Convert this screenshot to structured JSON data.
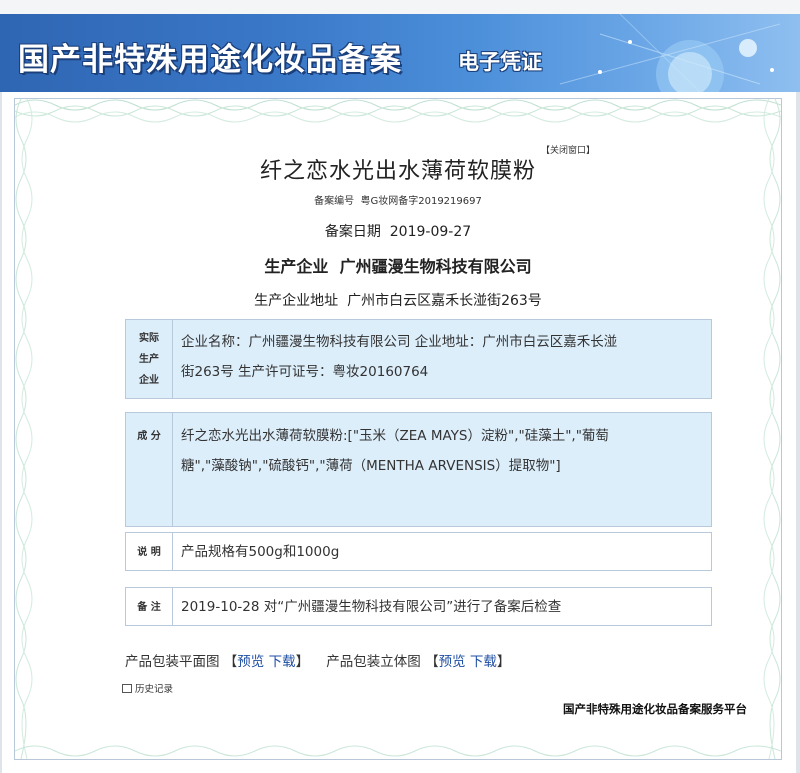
{
  "banner": {
    "title": "国产非特殊用途化妆品备案",
    "subtitle": "电子凭证"
  },
  "close_link": "【关闭窗口】",
  "product_name": "纤之恋水光出水薄荷软膜粉",
  "registration": {
    "number_label": "备案编号",
    "number": "粤G妆网备字2019219697",
    "date_label": "备案日期",
    "date": "2019-09-27"
  },
  "manufacturer": {
    "label": "生产企业",
    "name": "广州疆漫生物科技有限公司",
    "address_label": "生产企业地址",
    "address": "广州市白云区嘉禾长湴街263号"
  },
  "sections": {
    "actual_company": {
      "label_lines": [
        "实际",
        "生产",
        "企业"
      ],
      "line1": "企业名称：广州疆漫生物科技有限公司 企业地址：广州市白云区嘉禾长湴",
      "line2": "街263号 生产许可证号：粤妆20160764"
    },
    "ingredients": {
      "label": "成 分",
      "line1": "纤之恋水光出水薄荷软膜粉:[\"玉米（ZEA MAYS）淀粉\",\"硅藻土\",\"葡萄",
      "line2": "糖\",\"藻酸钠\",\"硫酸钙\",\"薄荷（MENTHA ARVENSIS）提取物\"]"
    },
    "description": {
      "label": "说 明",
      "text": "产品规格有500g和1000g"
    },
    "remarks": {
      "label": "备 注",
      "text": "2019-10-28 对“广州疆漫生物科技有限公司”进行了备案后检查"
    }
  },
  "packaging": {
    "flat_label": "产品包装平面图",
    "solid_label": "产品包装立体图",
    "open_bracket": "【",
    "close_bracket": "】",
    "preview": "预览",
    "download": "下载"
  },
  "history_link": "历史记录",
  "footer_brand": "国产非特殊用途化妆品备案服务平台",
  "colors": {
    "banner_blue": "#3a78c8",
    "section_blue": "#ddeefb",
    "link_blue": "#1f4fa3"
  }
}
